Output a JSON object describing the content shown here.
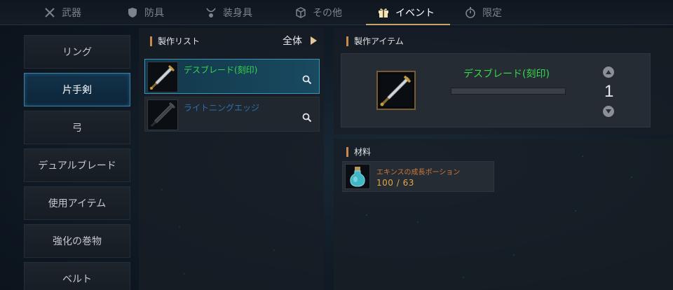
{
  "tabs": [
    {
      "label": "武器",
      "icon": "crossed-swords-icon"
    },
    {
      "label": "防具",
      "icon": "shield-icon"
    },
    {
      "label": "装身具",
      "icon": "necklace-icon"
    },
    {
      "label": "その他",
      "icon": "box-icon"
    },
    {
      "label": "イベント",
      "icon": "gift-icon",
      "active": true
    },
    {
      "label": "限定",
      "icon": "stopwatch-icon"
    }
  ],
  "categories": [
    {
      "label": "リング"
    },
    {
      "label": "片手剣",
      "active": true
    },
    {
      "label": "弓"
    },
    {
      "label": "デュアルブレード"
    },
    {
      "label": "使用アイテム"
    },
    {
      "label": "強化の巻物"
    },
    {
      "label": "ベルト"
    }
  ],
  "craft_list": {
    "title": "製作リスト",
    "filter_label": "全体",
    "items": [
      {
        "name": "デスブレード(刻印)",
        "color": "#38d64c",
        "selected": true
      },
      {
        "name": "ライトニングエッジ",
        "color": "#2f6fb1",
        "selected": false
      }
    ]
  },
  "craft_item": {
    "title": "製作アイテム",
    "name": "デスブレード(刻印)",
    "quantity": "1",
    "progress": 0
  },
  "materials": {
    "title": "材料",
    "items": [
      {
        "name": "エキンスの成長ポーション",
        "count": "100 / 63"
      }
    ]
  }
}
